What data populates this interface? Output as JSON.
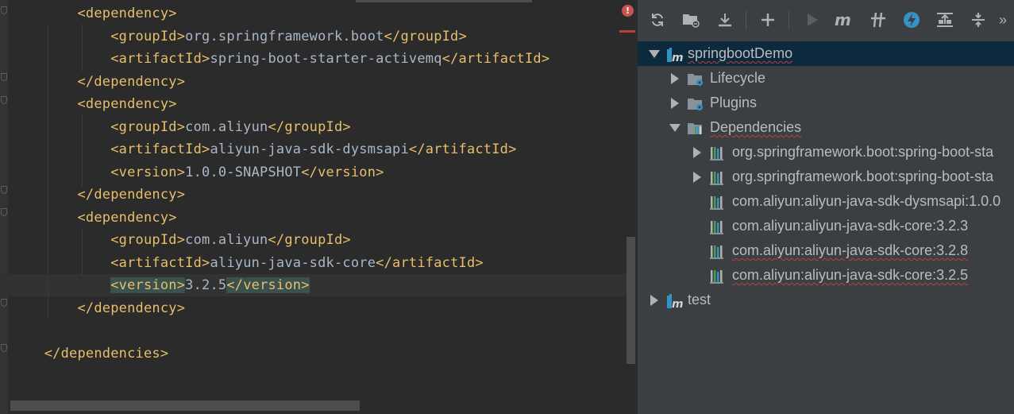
{
  "editor": {
    "lines": [
      {
        "indent": "        ",
        "parts": [
          {
            "k": "b",
            "t": "<"
          },
          {
            "k": "tag",
            "t": "dependency"
          },
          {
            "k": "b",
            "t": ">"
          }
        ]
      },
      {
        "indent": "            ",
        "parts": [
          {
            "k": "b",
            "t": "<"
          },
          {
            "k": "tag",
            "t": "groupId"
          },
          {
            "k": "b",
            "t": ">"
          },
          {
            "k": "txt",
            "t": "org.springframework.boot"
          },
          {
            "k": "b",
            "t": "</"
          },
          {
            "k": "tag",
            "t": "groupId"
          },
          {
            "k": "b",
            "t": ">"
          }
        ]
      },
      {
        "indent": "            ",
        "parts": [
          {
            "k": "b",
            "t": "<"
          },
          {
            "k": "tag",
            "t": "artifactId"
          },
          {
            "k": "b",
            "t": ">"
          },
          {
            "k": "txt",
            "t": "spring-boot-starter-activemq"
          },
          {
            "k": "b",
            "t": "</"
          },
          {
            "k": "tag",
            "t": "artifactId"
          },
          {
            "k": "b",
            "t": ">"
          }
        ]
      },
      {
        "indent": "        ",
        "parts": [
          {
            "k": "b",
            "t": "</"
          },
          {
            "k": "tag",
            "t": "dependency"
          },
          {
            "k": "b",
            "t": ">"
          }
        ]
      },
      {
        "indent": "        ",
        "parts": [
          {
            "k": "b",
            "t": "<"
          },
          {
            "k": "tag",
            "t": "dependency"
          },
          {
            "k": "b",
            "t": ">"
          }
        ]
      },
      {
        "indent": "            ",
        "parts": [
          {
            "k": "b",
            "t": "<"
          },
          {
            "k": "tag",
            "t": "groupId"
          },
          {
            "k": "b",
            "t": ">"
          },
          {
            "k": "txt",
            "t": "com.aliyun"
          },
          {
            "k": "b",
            "t": "</"
          },
          {
            "k": "tag",
            "t": "groupId"
          },
          {
            "k": "b",
            "t": ">"
          }
        ]
      },
      {
        "indent": "            ",
        "parts": [
          {
            "k": "b",
            "t": "<"
          },
          {
            "k": "tag",
            "t": "artifactId"
          },
          {
            "k": "b",
            "t": ">"
          },
          {
            "k": "txt",
            "t": "aliyun-java-sdk-dysmsapi"
          },
          {
            "k": "b",
            "t": "</"
          },
          {
            "k": "tag",
            "t": "artifactId"
          },
          {
            "k": "b",
            "t": ">"
          }
        ]
      },
      {
        "indent": "            ",
        "parts": [
          {
            "k": "b",
            "t": "<"
          },
          {
            "k": "tag",
            "t": "version"
          },
          {
            "k": "b",
            "t": ">"
          },
          {
            "k": "txt",
            "t": "1.0.0-SNAPSHOT"
          },
          {
            "k": "b",
            "t": "</"
          },
          {
            "k": "tag",
            "t": "version"
          },
          {
            "k": "b",
            "t": ">"
          }
        ]
      },
      {
        "indent": "        ",
        "parts": [
          {
            "k": "b",
            "t": "</"
          },
          {
            "k": "tag",
            "t": "dependency"
          },
          {
            "k": "b",
            "t": ">"
          }
        ]
      },
      {
        "indent": "        ",
        "parts": [
          {
            "k": "b",
            "t": "<"
          },
          {
            "k": "tag",
            "t": "dependency"
          },
          {
            "k": "b",
            "t": ">"
          }
        ]
      },
      {
        "indent": "            ",
        "parts": [
          {
            "k": "b",
            "t": "<"
          },
          {
            "k": "tag",
            "t": "groupId"
          },
          {
            "k": "b",
            "t": ">"
          },
          {
            "k": "txt",
            "t": "com.aliyun"
          },
          {
            "k": "b",
            "t": "</"
          },
          {
            "k": "tag",
            "t": "groupId"
          },
          {
            "k": "b",
            "t": ">"
          }
        ]
      },
      {
        "indent": "            ",
        "parts": [
          {
            "k": "b",
            "t": "<"
          },
          {
            "k": "tag",
            "t": "artifactId"
          },
          {
            "k": "b",
            "t": ">"
          },
          {
            "k": "txt",
            "t": "aliyun-java-sdk-core"
          },
          {
            "k": "b",
            "t": "</"
          },
          {
            "k": "tag",
            "t": "artifactId"
          },
          {
            "k": "b",
            "t": ">"
          }
        ]
      },
      {
        "indent": "            ",
        "parts": [
          {
            "k": "hl",
            "t": "<version>"
          },
          {
            "k": "txt",
            "t": "3.2.5"
          },
          {
            "k": "hl",
            "t": "</version>"
          }
        ]
      },
      {
        "indent": "        ",
        "parts": [
          {
            "k": "b",
            "t": "</"
          },
          {
            "k": "tag",
            "t": "dependency"
          },
          {
            "k": "b",
            "t": ">"
          }
        ]
      },
      {
        "indent": "",
        "parts": []
      },
      {
        "indent": "    ",
        "parts": [
          {
            "k": "b",
            "t": "</"
          },
          {
            "k": "tag",
            "t": "dependencies"
          },
          {
            "k": "b",
            "t": ">"
          }
        ]
      }
    ],
    "error_glyph": "!"
  },
  "toolbar": {
    "buttons": [
      {
        "name": "reimport-all-icon"
      },
      {
        "name": "generate-sources-icon"
      },
      {
        "name": "download-sources-icon"
      },
      {
        "name": "add-maven-project-icon"
      },
      {
        "name": "run-maven-build-icon"
      },
      {
        "name": "execute-maven-goal-icon"
      },
      {
        "name": "toggle-offline-mode-icon"
      },
      {
        "name": "skip-tests-icon"
      },
      {
        "name": "show-dependencies-icon"
      },
      {
        "name": "collapse-all-icon"
      }
    ],
    "overflow": "»"
  },
  "tree": {
    "nodes": [
      {
        "label": "springbootDemo",
        "level": 0,
        "arrow": "down",
        "icon": "maven-project-icon",
        "selected": true,
        "squiggle": true
      },
      {
        "label": "Lifecycle",
        "level": 1,
        "arrow": "right",
        "icon": "lifecycle-folder-icon",
        "selected": false,
        "squiggle": false
      },
      {
        "label": "Plugins",
        "level": 1,
        "arrow": "right",
        "icon": "plugins-folder-icon",
        "selected": false,
        "squiggle": false
      },
      {
        "label": "Dependencies",
        "level": 1,
        "arrow": "down",
        "icon": "dependencies-folder-icon",
        "selected": false,
        "squiggle": true
      },
      {
        "label": "org.springframework.boot:spring-boot-sta",
        "level": 2,
        "arrow": "right",
        "icon": "library-icon",
        "selected": false,
        "squiggle": false
      },
      {
        "label": "org.springframework.boot:spring-boot-sta",
        "level": 2,
        "arrow": "right",
        "icon": "library-icon",
        "selected": false,
        "squiggle": false
      },
      {
        "label": "com.aliyun:aliyun-java-sdk-dysmsapi:1.0.0",
        "level": 2,
        "arrow": "none",
        "icon": "library-icon",
        "selected": false,
        "squiggle": false
      },
      {
        "label": "com.aliyun:aliyun-java-sdk-core:3.2.3",
        "level": 2,
        "arrow": "none",
        "icon": "library-icon",
        "selected": false,
        "squiggle": false
      },
      {
        "label": "com.aliyun:aliyun-java-sdk-core:3.2.8",
        "level": 2,
        "arrow": "none",
        "icon": "library-icon",
        "selected": false,
        "squiggle": true
      },
      {
        "label": "com.aliyun:aliyun-java-sdk-core:3.2.5",
        "level": 2,
        "arrow": "none",
        "icon": "library-icon",
        "selected": false,
        "squiggle": true
      },
      {
        "label": "test",
        "level": 0,
        "arrow": "right",
        "icon": "maven-project-icon",
        "selected": false,
        "squiggle": false
      }
    ]
  },
  "colors": {
    "tag": "#e8bf6a",
    "text": "#a9b7c6",
    "selection": "#0d293e",
    "error": "#c75450",
    "accent": "#3592c4"
  }
}
